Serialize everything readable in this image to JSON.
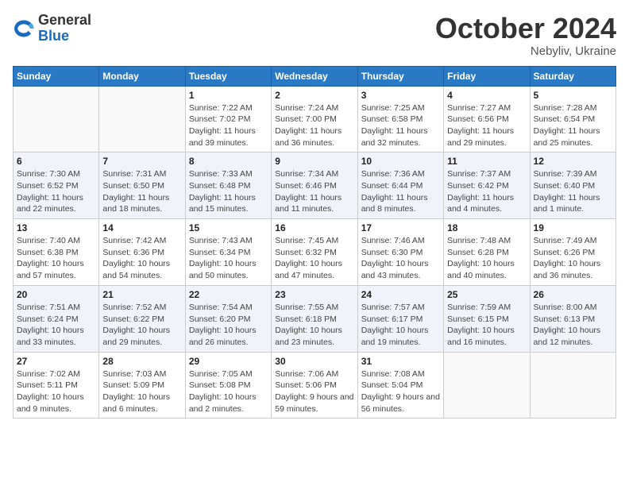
{
  "header": {
    "logo_general": "General",
    "logo_blue": "Blue",
    "month_title": "October 2024",
    "location": "Nebyliv, Ukraine"
  },
  "weekdays": [
    "Sunday",
    "Monday",
    "Tuesday",
    "Wednesday",
    "Thursday",
    "Friday",
    "Saturday"
  ],
  "weeks": [
    [
      {
        "day": "",
        "info": ""
      },
      {
        "day": "",
        "info": ""
      },
      {
        "day": "1",
        "info": "Sunrise: 7:22 AM\nSunset: 7:02 PM\nDaylight: 11 hours and 39 minutes."
      },
      {
        "day": "2",
        "info": "Sunrise: 7:24 AM\nSunset: 7:00 PM\nDaylight: 11 hours and 36 minutes."
      },
      {
        "day": "3",
        "info": "Sunrise: 7:25 AM\nSunset: 6:58 PM\nDaylight: 11 hours and 32 minutes."
      },
      {
        "day": "4",
        "info": "Sunrise: 7:27 AM\nSunset: 6:56 PM\nDaylight: 11 hours and 29 minutes."
      },
      {
        "day": "5",
        "info": "Sunrise: 7:28 AM\nSunset: 6:54 PM\nDaylight: 11 hours and 25 minutes."
      }
    ],
    [
      {
        "day": "6",
        "info": "Sunrise: 7:30 AM\nSunset: 6:52 PM\nDaylight: 11 hours and 22 minutes."
      },
      {
        "day": "7",
        "info": "Sunrise: 7:31 AM\nSunset: 6:50 PM\nDaylight: 11 hours and 18 minutes."
      },
      {
        "day": "8",
        "info": "Sunrise: 7:33 AM\nSunset: 6:48 PM\nDaylight: 11 hours and 15 minutes."
      },
      {
        "day": "9",
        "info": "Sunrise: 7:34 AM\nSunset: 6:46 PM\nDaylight: 11 hours and 11 minutes."
      },
      {
        "day": "10",
        "info": "Sunrise: 7:36 AM\nSunset: 6:44 PM\nDaylight: 11 hours and 8 minutes."
      },
      {
        "day": "11",
        "info": "Sunrise: 7:37 AM\nSunset: 6:42 PM\nDaylight: 11 hours and 4 minutes."
      },
      {
        "day": "12",
        "info": "Sunrise: 7:39 AM\nSunset: 6:40 PM\nDaylight: 11 hours and 1 minute."
      }
    ],
    [
      {
        "day": "13",
        "info": "Sunrise: 7:40 AM\nSunset: 6:38 PM\nDaylight: 10 hours and 57 minutes."
      },
      {
        "day": "14",
        "info": "Sunrise: 7:42 AM\nSunset: 6:36 PM\nDaylight: 10 hours and 54 minutes."
      },
      {
        "day": "15",
        "info": "Sunrise: 7:43 AM\nSunset: 6:34 PM\nDaylight: 10 hours and 50 minutes."
      },
      {
        "day": "16",
        "info": "Sunrise: 7:45 AM\nSunset: 6:32 PM\nDaylight: 10 hours and 47 minutes."
      },
      {
        "day": "17",
        "info": "Sunrise: 7:46 AM\nSunset: 6:30 PM\nDaylight: 10 hours and 43 minutes."
      },
      {
        "day": "18",
        "info": "Sunrise: 7:48 AM\nSunset: 6:28 PM\nDaylight: 10 hours and 40 minutes."
      },
      {
        "day": "19",
        "info": "Sunrise: 7:49 AM\nSunset: 6:26 PM\nDaylight: 10 hours and 36 minutes."
      }
    ],
    [
      {
        "day": "20",
        "info": "Sunrise: 7:51 AM\nSunset: 6:24 PM\nDaylight: 10 hours and 33 minutes."
      },
      {
        "day": "21",
        "info": "Sunrise: 7:52 AM\nSunset: 6:22 PM\nDaylight: 10 hours and 29 minutes."
      },
      {
        "day": "22",
        "info": "Sunrise: 7:54 AM\nSunset: 6:20 PM\nDaylight: 10 hours and 26 minutes."
      },
      {
        "day": "23",
        "info": "Sunrise: 7:55 AM\nSunset: 6:18 PM\nDaylight: 10 hours and 23 minutes."
      },
      {
        "day": "24",
        "info": "Sunrise: 7:57 AM\nSunset: 6:17 PM\nDaylight: 10 hours and 19 minutes."
      },
      {
        "day": "25",
        "info": "Sunrise: 7:59 AM\nSunset: 6:15 PM\nDaylight: 10 hours and 16 minutes."
      },
      {
        "day": "26",
        "info": "Sunrise: 8:00 AM\nSunset: 6:13 PM\nDaylight: 10 hours and 12 minutes."
      }
    ],
    [
      {
        "day": "27",
        "info": "Sunrise: 7:02 AM\nSunset: 5:11 PM\nDaylight: 10 hours and 9 minutes."
      },
      {
        "day": "28",
        "info": "Sunrise: 7:03 AM\nSunset: 5:09 PM\nDaylight: 10 hours and 6 minutes."
      },
      {
        "day": "29",
        "info": "Sunrise: 7:05 AM\nSunset: 5:08 PM\nDaylight: 10 hours and 2 minutes."
      },
      {
        "day": "30",
        "info": "Sunrise: 7:06 AM\nSunset: 5:06 PM\nDaylight: 9 hours and 59 minutes."
      },
      {
        "day": "31",
        "info": "Sunrise: 7:08 AM\nSunset: 5:04 PM\nDaylight: 9 hours and 56 minutes."
      },
      {
        "day": "",
        "info": ""
      },
      {
        "day": "",
        "info": ""
      }
    ]
  ]
}
